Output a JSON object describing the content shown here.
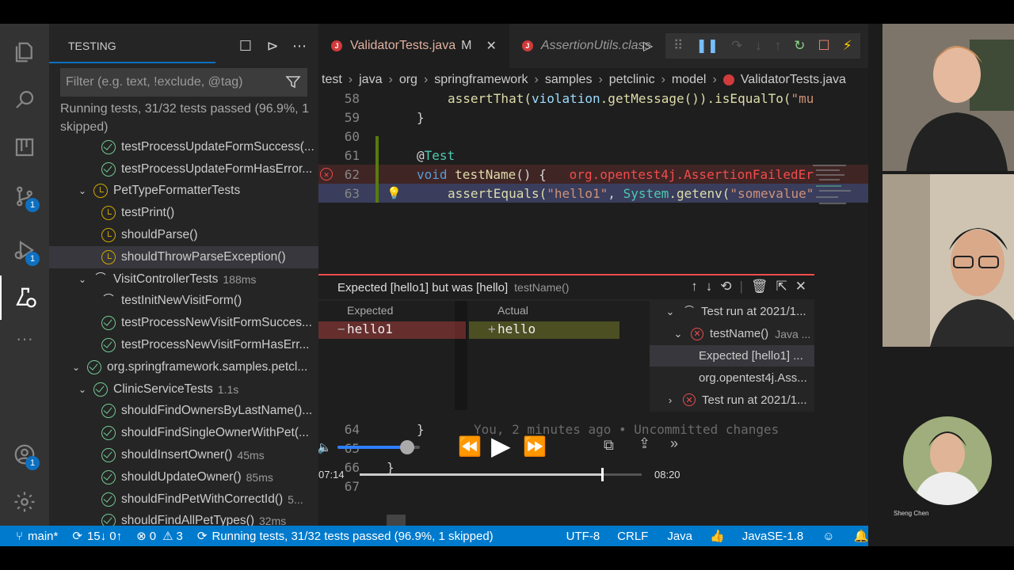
{
  "activity": {
    "badges": [
      "1",
      "1",
      "1"
    ]
  },
  "sidebar": {
    "title": "TESTING",
    "filter_placeholder": "Filter (e.g. text, !exclude, @tag)",
    "status_msg": "Running tests, 31/32 tests passed (96.9%, 1 skipped)",
    "tree": [
      {
        "label": "testProcessUpdateFormSuccess(...",
        "state": "pass",
        "indent": 2
      },
      {
        "label": "testProcessUpdateFormHasError...",
        "state": "pass",
        "indent": 2
      },
      {
        "label": "PetTypeFormatterTests",
        "state": "skip",
        "indent": 1,
        "chev": "⌄"
      },
      {
        "label": "testPrint()",
        "state": "skip",
        "indent": 2
      },
      {
        "label": "shouldParse()",
        "state": "skip",
        "indent": 2
      },
      {
        "label": "shouldThrowParseException()",
        "state": "skip",
        "indent": 2,
        "sel": true
      },
      {
        "label": "VisitControllerTests",
        "state": "run",
        "indent": 1,
        "chev": "⌄",
        "dur": "188ms"
      },
      {
        "label": "testInitNewVisitForm()",
        "state": "run",
        "indent": 2
      },
      {
        "label": "testProcessNewVisitFormSucces...",
        "state": "pass",
        "indent": 2
      },
      {
        "label": "testProcessNewVisitFormHasErr...",
        "state": "pass",
        "indent": 2
      },
      {
        "label": "org.springframework.samples.petcl...",
        "state": "pass",
        "indent": 0,
        "chev": "⌄"
      },
      {
        "label": "ClinicServiceTests",
        "state": "pass",
        "indent": 1,
        "chev": "⌄",
        "dur": "1.1s"
      },
      {
        "label": "shouldFindOwnersByLastName()...",
        "state": "pass",
        "indent": 2
      },
      {
        "label": "shouldFindSingleOwnerWithPet(...",
        "state": "pass",
        "indent": 2
      },
      {
        "label": "shouldInsertOwner()",
        "state": "pass",
        "indent": 2,
        "dur": "45ms"
      },
      {
        "label": "shouldUpdateOwner()",
        "state": "pass",
        "indent": 2,
        "dur": "85ms"
      },
      {
        "label": "shouldFindPetWithCorrectId()",
        "state": "pass",
        "indent": 2,
        "dur": "5..."
      },
      {
        "label": "shouldFindAllPetTypes()",
        "state": "pass",
        "indent": 2,
        "dur": "32ms"
      }
    ]
  },
  "tabs": [
    {
      "name": "ValidatorTests.java",
      "mod": "M"
    },
    {
      "name": "AssertionUtils.class"
    }
  ],
  "breadcrumb": [
    "test",
    "java",
    "org",
    "springframework",
    "samples",
    "petclinic",
    "model",
    "ValidatorTests.java"
  ],
  "code": {
    "l58": {
      "n": "58",
      "a": "assertThat(",
      "b": "violation",
      "c": ".getMessage()).isEqualTo(",
      "d": "\"mu"
    },
    "l59": {
      "n": "59",
      "t": "}"
    },
    "l60": {
      "n": "60",
      "t": ""
    },
    "l61": {
      "n": "61",
      "a": "@",
      "b": "Test"
    },
    "l62": {
      "n": "62",
      "a": "void",
      "b": "testName",
      "c": "() {",
      "d": "org.opentest4j.AssertionFailedEr"
    },
    "l63": {
      "n": "63",
      "a": "assertEquals(",
      "b": "\"hello1\"",
      "c": ", ",
      "d": "System",
      "e": ".getenv(",
      "f": "\"somevalue\""
    },
    "l64": {
      "n": "64",
      "t": "}",
      "blame": "You, 2 minutes ago • Uncommitted changes"
    },
    "l65": {
      "n": "65",
      "t": ""
    },
    "l66": {
      "n": "66",
      "t": "}"
    },
    "l67": {
      "n": "67",
      "t": ""
    }
  },
  "peek": {
    "title": "Expected [hello1] but was [hello]",
    "sub": "testName()",
    "expected_hdr": "Expected",
    "actual_hdr": "Actual",
    "expected": "hello1",
    "actual": "hello",
    "results": [
      {
        "label": "Test run at 2021/1...",
        "state": "run",
        "chev": "⌄",
        "indent": 0
      },
      {
        "label": "testName()",
        "sub": "Java ...",
        "state": "fail",
        "chev": "⌄",
        "indent": 1
      },
      {
        "label": "Expected [hello1] ...",
        "indent": 2,
        "sel": true
      },
      {
        "label": "org.opentest4j.Ass...",
        "indent": 2
      },
      {
        "label": "Test run at 2021/1...",
        "state": "fail",
        "chev": "›",
        "indent": 0
      }
    ]
  },
  "video": {
    "current": "07:14",
    "total": "08:20",
    "progress": 0.86,
    "volume": 0.85
  },
  "statusbar": {
    "branch": "main*",
    "sync": "15↓ 0↑",
    "errors": "0",
    "warnings": "3",
    "running": "Running tests, 31/32 tests passed (96.9%, 1 skipped)",
    "encoding": "UTF-8",
    "eol": "CRLF",
    "lang": "Java",
    "jdk": "JavaSE-1.8"
  },
  "cams": {
    "name": "Sheng Chen"
  }
}
